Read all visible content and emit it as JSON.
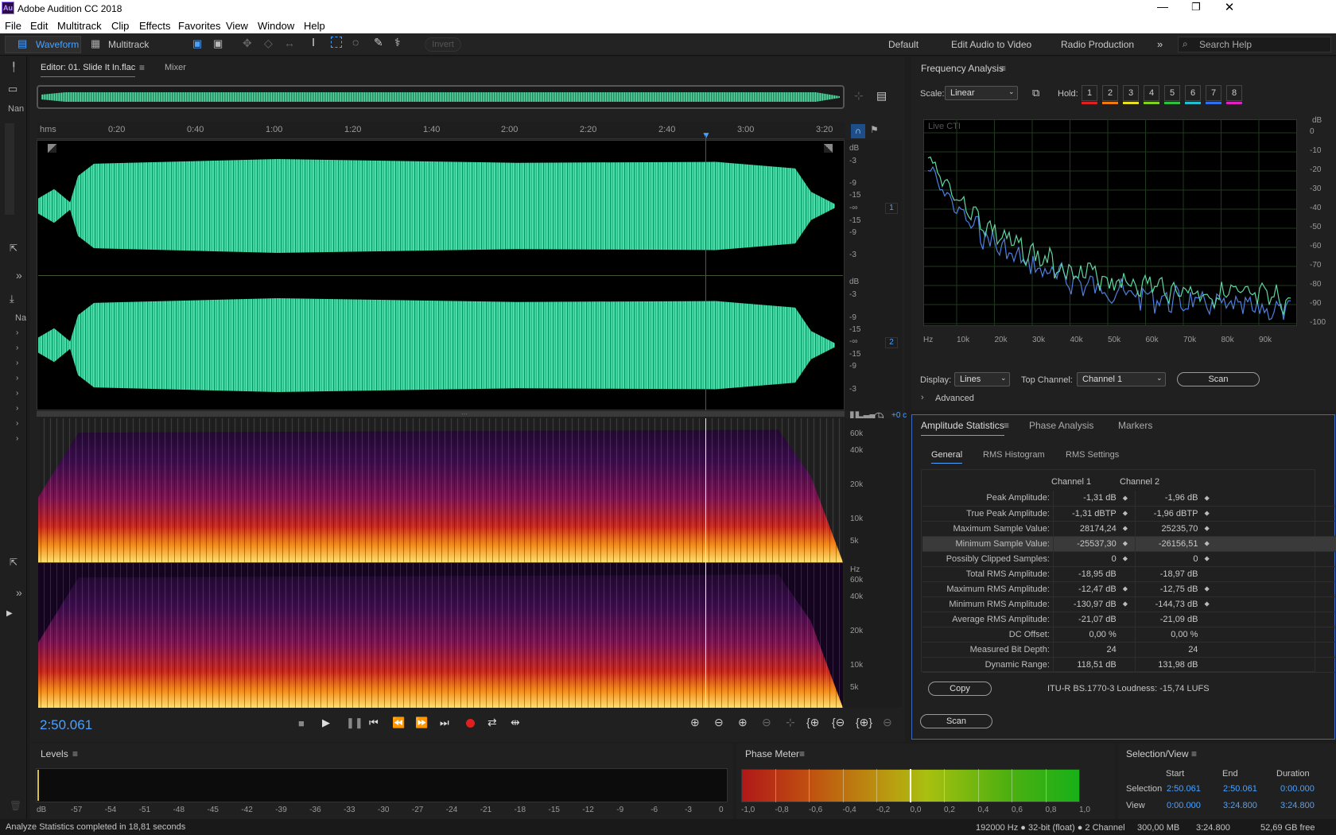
{
  "window": {
    "title": "Adobe Audition CC 2018",
    "app_icon": "Au"
  },
  "menu": [
    "File",
    "Edit",
    "Multitrack",
    "Clip",
    "Effects",
    "Favorites",
    "View",
    "Window",
    "Help"
  ],
  "toolbar": {
    "waveform": "Waveform",
    "multitrack": "Multitrack",
    "invert": "Invert",
    "workspaces": [
      "Default",
      "Edit Audio to Video",
      "Radio Production"
    ],
    "search_placeholder": "Search Help"
  },
  "left_strip": {
    "nam": "Nan",
    "na": "Na"
  },
  "editor": {
    "tab": "Editor: 01. Slide It In.flac",
    "mixer_tab": "Mixer",
    "time_ruler": [
      "hms",
      "0:20",
      "0:40",
      "1:00",
      "1:20",
      "1:40",
      "2:00",
      "2:20",
      "2:40",
      "3:00",
      "3:20"
    ],
    "db_scale": [
      "dB",
      "-3",
      "-9",
      "-15",
      "-∞",
      "-15",
      "-9",
      "-3"
    ],
    "hz_top": [
      "60k",
      "40k",
      "20k",
      "10k",
      "5k"
    ],
    "hz_bottom": [
      "Hz",
      "60k",
      "40k",
      "20k",
      "10k",
      "5k"
    ],
    "channel_labels": [
      "1",
      "2"
    ],
    "current_time": "2:50.061",
    "zoom_readout": "+0 c"
  },
  "frequency_analysis": {
    "title": "Frequency Analysis",
    "scale_label": "Scale:",
    "scale_value": "Linear",
    "hold_label": "Hold:",
    "hold_buttons": [
      "1",
      "2",
      "3",
      "4",
      "5",
      "6",
      "7",
      "8"
    ],
    "hold_colors": [
      "#e02020",
      "#f07a10",
      "#e8e020",
      "#80d020",
      "#30c040",
      "#20c0d0",
      "#3070f0",
      "#e020c0"
    ],
    "live_cti": "Live CTI",
    "db_ticks": [
      "dB",
      "0",
      "-10",
      "-20",
      "-30",
      "-40",
      "-50",
      "-60",
      "-70",
      "-80",
      "-90",
      "-100"
    ],
    "hz_ticks": [
      "Hz",
      "10k",
      "20k",
      "30k",
      "40k",
      "50k",
      "60k",
      "70k",
      "80k",
      "90k"
    ],
    "display_label": "Display:",
    "display_value": "Lines",
    "top_channel_label": "Top Channel:",
    "top_channel_value": "Channel 1",
    "scan": "Scan",
    "advanced": "Advanced",
    "line_colors": {
      "channel1": "#5fd7a0",
      "channel2": "#4f7fe0"
    }
  },
  "amplitude": {
    "tabs": [
      "Amplitude Statistics",
      "Phase Analysis",
      "Markers"
    ],
    "subtabs": [
      "General",
      "RMS Histogram",
      "RMS Settings"
    ],
    "col1": "Channel 1",
    "col2": "Channel 2",
    "rows": [
      {
        "label": "Peak Amplitude:",
        "c1": "-1,31 dB",
        "c2": "-1,96 dB",
        "pin": true
      },
      {
        "label": "True Peak Amplitude:",
        "c1": "-1,31 dBTP",
        "c2": "-1,96 dBTP",
        "pin": true
      },
      {
        "label": "Maximum Sample Value:",
        "c1": "28174,24",
        "c2": "25235,70",
        "pin": true
      },
      {
        "label": "Minimum Sample Value:",
        "c1": "-25537,30",
        "c2": "-26156,51",
        "pin": true
      },
      {
        "label": "Possibly Clipped Samples:",
        "c1": "0",
        "c2": "0",
        "pin": true
      },
      {
        "label": "Total RMS Amplitude:",
        "c1": "-18,95 dB",
        "c2": "-18,97 dB",
        "pin": false
      },
      {
        "label": "Maximum RMS Amplitude:",
        "c1": "-12,47 dB",
        "c2": "-12,75 dB",
        "pin": true
      },
      {
        "label": "Minimum RMS Amplitude:",
        "c1": "-130,97 dB",
        "c2": "-144,73 dB",
        "pin": true
      },
      {
        "label": "Average RMS Amplitude:",
        "c1": "-21,07 dB",
        "c2": "-21,09 dB",
        "pin": false
      },
      {
        "label": "DC Offset:",
        "c1": "0,00 %",
        "c2": "0,00 %",
        "pin": false
      },
      {
        "label": "Measured Bit Depth:",
        "c1": "24",
        "c2": "24",
        "pin": false
      },
      {
        "label": "Dynamic Range:",
        "c1": "118,51 dB",
        "c2": "131,98 dB",
        "pin": false
      }
    ],
    "copy": "Copy",
    "loudness": "ITU-R BS.1770-3 Loudness:  -15,74 LUFS",
    "scan": "Scan"
  },
  "levels": {
    "title": "Levels",
    "ticks": [
      "dB",
      "-57",
      "-54",
      "-51",
      "-48",
      "-45",
      "-42",
      "-39",
      "-36",
      "-33",
      "-30",
      "-27",
      "-24",
      "-21",
      "-18",
      "-15",
      "-12",
      "-9",
      "-6",
      "-3",
      "0"
    ]
  },
  "phase_meter": {
    "title": "Phase Meter",
    "ticks": [
      "-1,0",
      "-0,8",
      "-0,6",
      "-0,4",
      "-0,2",
      "0,0",
      "0,2",
      "0,4",
      "0,6",
      "0,8",
      "1,0"
    ]
  },
  "selection_view": {
    "title": "Selection/View",
    "headers": [
      "Start",
      "End",
      "Duration"
    ],
    "selection_label": "Selection",
    "selection": [
      "2:50.061",
      "2:50.061",
      "0:00.000"
    ],
    "view_label": "View",
    "view": [
      "0:00.000",
      "3:24.800",
      "3:24.800"
    ]
  },
  "status": {
    "message": "Analyze Statistics completed in 18,81 seconds",
    "format": "192000 Hz ● 32-bit (float) ● 2 Channel",
    "size": "300,00 MB",
    "duration": "3:24.800",
    "free": "52,69 GB free"
  }
}
